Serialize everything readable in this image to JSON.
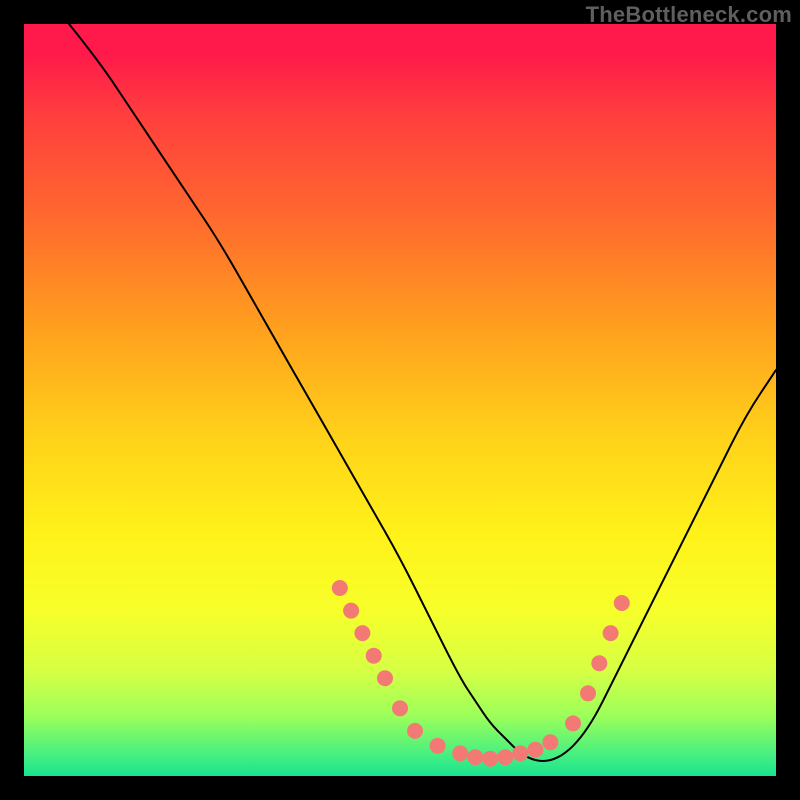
{
  "watermark": "TheBottleneck.com",
  "chart_data": {
    "type": "line",
    "title": "",
    "xlabel": "",
    "ylabel": "",
    "xlim": [
      0,
      100
    ],
    "ylim": [
      0,
      100
    ],
    "grid": false,
    "legend": false,
    "series": [
      {
        "name": "bottleneck-curve",
        "color": "#000000",
        "x": [
          6,
          10,
          14,
          18,
          22,
          26,
          30,
          34,
          38,
          42,
          46,
          50,
          54,
          58,
          60,
          62,
          64,
          66,
          68,
          70,
          72,
          74,
          76,
          78,
          80,
          84,
          88,
          92,
          96,
          100
        ],
        "y": [
          100,
          95,
          89,
          83,
          77,
          71,
          64,
          57,
          50,
          43,
          36,
          29,
          21,
          13,
          10,
          7,
          5,
          3,
          2,
          2,
          3,
          5,
          8,
          12,
          16,
          24,
          32,
          40,
          48,
          54
        ]
      }
    ],
    "highlight_points": {
      "name": "salmon-dots",
      "color": "#f37a74",
      "radius": 8,
      "points": [
        {
          "x": 42,
          "y": 25
        },
        {
          "x": 43.5,
          "y": 22
        },
        {
          "x": 45,
          "y": 19
        },
        {
          "x": 46.5,
          "y": 16
        },
        {
          "x": 48,
          "y": 13
        },
        {
          "x": 50,
          "y": 9
        },
        {
          "x": 52,
          "y": 6
        },
        {
          "x": 55,
          "y": 4
        },
        {
          "x": 58,
          "y": 3
        },
        {
          "x": 60,
          "y": 2.5
        },
        {
          "x": 62,
          "y": 2.3
        },
        {
          "x": 64,
          "y": 2.5
        },
        {
          "x": 66,
          "y": 3
        },
        {
          "x": 68,
          "y": 3.5
        },
        {
          "x": 70,
          "y": 4.5
        },
        {
          "x": 73,
          "y": 7
        },
        {
          "x": 75,
          "y": 11
        },
        {
          "x": 76.5,
          "y": 15
        },
        {
          "x": 78,
          "y": 19
        },
        {
          "x": 79.5,
          "y": 23
        }
      ]
    },
    "gradient_stops": [
      {
        "pos": 0,
        "color": "#ff1a4b"
      },
      {
        "pos": 50,
        "color": "#ffd21a"
      },
      {
        "pos": 100,
        "color": "#19e38f"
      }
    ]
  }
}
